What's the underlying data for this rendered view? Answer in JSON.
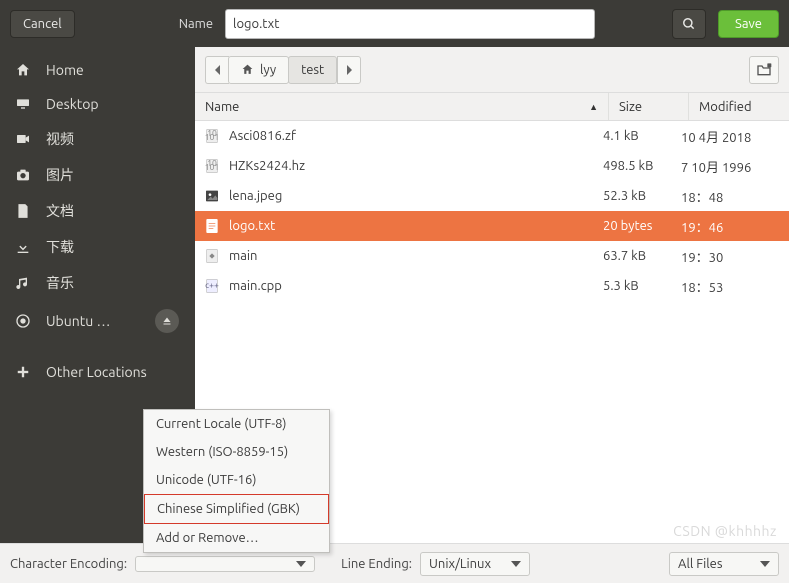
{
  "topbar": {
    "cancel_label": "Cancel",
    "name_label": "Name",
    "name_value": "logo.txt",
    "name_selection": "logo",
    "name_rest": ".txt",
    "save_label": "Save"
  },
  "sidebar": {
    "items": [
      {
        "icon": "home-icon",
        "label": "Home"
      },
      {
        "icon": "desktop-icon",
        "label": "Desktop"
      },
      {
        "icon": "video-icon",
        "label": "视频"
      },
      {
        "icon": "camera-icon",
        "label": "图片"
      },
      {
        "icon": "document-icon",
        "label": "文档"
      },
      {
        "icon": "download-icon",
        "label": "下载"
      },
      {
        "icon": "music-icon",
        "label": "音乐"
      },
      {
        "icon": "disc-icon",
        "label": "Ubuntu …",
        "eject": true
      }
    ],
    "other_locations": "Other Locations"
  },
  "path": {
    "crumbs": [
      "lyy",
      "test"
    ]
  },
  "table": {
    "headers": {
      "name": "Name",
      "size": "Size",
      "modified": "Modified"
    },
    "rows": [
      {
        "icon": "binfile-icon",
        "name": "Asci0816.zf",
        "size": "4.1 kB",
        "modified": "10 4月  2018"
      },
      {
        "icon": "binfile-icon",
        "name": "HZKs2424.hz",
        "size": "498.5 kB",
        "modified": "7 10月  1996"
      },
      {
        "icon": "image-icon",
        "name": "lena.jpeg",
        "size": "52.3 kB",
        "modified": "18：48"
      },
      {
        "icon": "textfile-icon",
        "name": "logo.txt",
        "size": "20 bytes",
        "modified": "19：46",
        "selected": true
      },
      {
        "icon": "exec-icon",
        "name": "main",
        "size": "63.7 kB",
        "modified": "19：30"
      },
      {
        "icon": "cppfile-icon",
        "name": "main.cpp",
        "size": "5.3 kB",
        "modified": "18：53"
      }
    ]
  },
  "encoding_menu": {
    "items": [
      "Current Locale (UTF-8)",
      "Western (ISO-8859-15)",
      "Unicode (UTF-16)",
      "Chinese Simplified (GBK)",
      "Add or Remove…"
    ],
    "highlighted_index": 3
  },
  "bottombar": {
    "encoding_label": "Character Encoding:",
    "encoding_value": "",
    "line_ending_label": "Line Ending:",
    "line_ending_value": "Unix/Linux",
    "file_filter": "All Files"
  },
  "watermark": "CSDN @khhhhz"
}
